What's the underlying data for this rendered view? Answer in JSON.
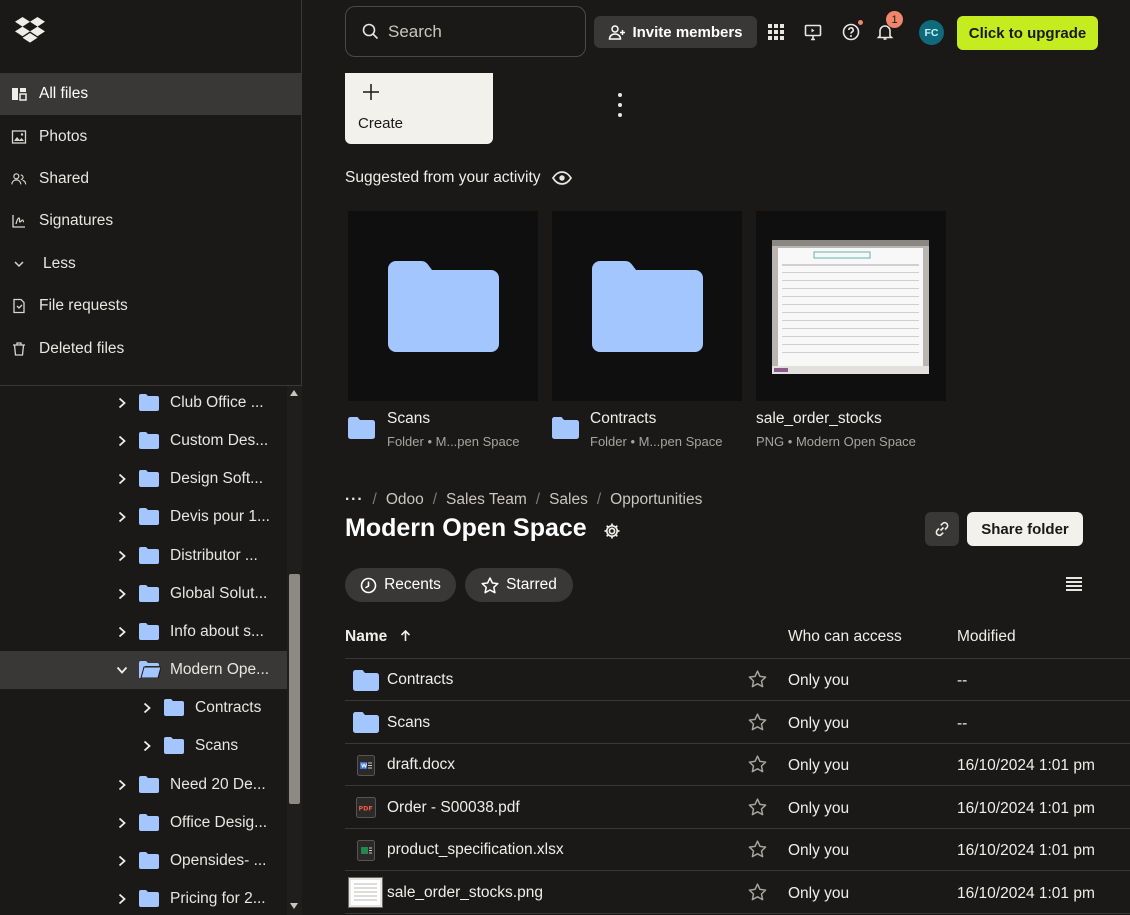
{
  "sidebar": {
    "nav": [
      {
        "label": "All files",
        "icon": "all-files-icon",
        "active": true
      },
      {
        "label": "Photos",
        "icon": "photos-icon"
      },
      {
        "label": "Shared",
        "icon": "shared-icon"
      },
      {
        "label": "Signatures",
        "icon": "signatures-icon"
      },
      {
        "label": "Less",
        "icon": "chevron-down-icon"
      },
      {
        "label": "File requests",
        "icon": "file-requests-icon"
      },
      {
        "label": "Deleted files",
        "icon": "trash-icon"
      }
    ],
    "tree": [
      {
        "label": "Club Office ...",
        "level": 0,
        "expanded": false
      },
      {
        "label": "Custom Des...",
        "level": 0,
        "expanded": false
      },
      {
        "label": "Design Soft...",
        "level": 0,
        "expanded": false
      },
      {
        "label": "Devis pour 1...",
        "level": 0,
        "expanded": false
      },
      {
        "label": "Distributor ...",
        "level": 0,
        "expanded": false
      },
      {
        "label": "Global Solut...",
        "level": 0,
        "expanded": false
      },
      {
        "label": "Info about s...",
        "level": 0,
        "expanded": false
      },
      {
        "label": "Modern Ope...",
        "level": 0,
        "expanded": true,
        "selected": true
      },
      {
        "label": "Contracts",
        "level": 1,
        "expanded": false
      },
      {
        "label": "Scans",
        "level": 1,
        "expanded": false
      },
      {
        "label": "Need 20 De...",
        "level": 0,
        "expanded": false
      },
      {
        "label": "Office Desig...",
        "level": 0,
        "expanded": false
      },
      {
        "label": "Opensides- ...",
        "level": 0,
        "expanded": false
      },
      {
        "label": "Pricing for 2...",
        "level": 0,
        "expanded": false
      }
    ]
  },
  "topbar": {
    "search_placeholder": "Search",
    "invite_label": "Invite members",
    "notification_count": "1",
    "avatar_initials": "FC",
    "upgrade_label": "Click to upgrade"
  },
  "create": {
    "label": "Create"
  },
  "suggested": {
    "title": "Suggested from your activity",
    "cards": [
      {
        "name": "Scans",
        "sub": "Folder • M...pen Space",
        "kind": "folder"
      },
      {
        "name": "Contracts",
        "sub": "Folder • M...pen Space",
        "kind": "folder"
      },
      {
        "name": "sale_order_stocks",
        "sub": "PNG • Modern Open Space",
        "kind": "image"
      }
    ]
  },
  "breadcrumb": {
    "items": [
      "Odoo",
      "Sales Team",
      "Sales",
      "Opportunities"
    ]
  },
  "page": {
    "title": "Modern Open Space",
    "share_label": "Share folder"
  },
  "filters": {
    "recents": "Recents",
    "starred": "Starred"
  },
  "table": {
    "headers": {
      "name": "Name",
      "access": "Who can access",
      "modified": "Modified"
    },
    "rows": [
      {
        "name": "Contracts",
        "type": "folder",
        "access": "Only you",
        "modified": "--"
      },
      {
        "name": "Scans",
        "type": "folder",
        "access": "Only you",
        "modified": "--"
      },
      {
        "name": "draft.docx",
        "type": "docx",
        "access": "Only you",
        "modified": "16/10/2024 1:01 pm"
      },
      {
        "name": "Order - S00038.pdf",
        "type": "pdf",
        "access": "Only you",
        "modified": "16/10/2024 1:01 pm"
      },
      {
        "name": "product_specification.xlsx",
        "type": "xlsx",
        "access": "Only you",
        "modified": "16/10/2024 1:01 pm"
      },
      {
        "name": "sale_order_stocks.png",
        "type": "png",
        "access": "Only you",
        "modified": "16/10/2024 1:01 pm"
      }
    ]
  },
  "colors": {
    "background": "#1a1918",
    "folder": "#a4c6ff",
    "upgrade": "#c4ec1f",
    "accent_badge": "#f2866d"
  }
}
